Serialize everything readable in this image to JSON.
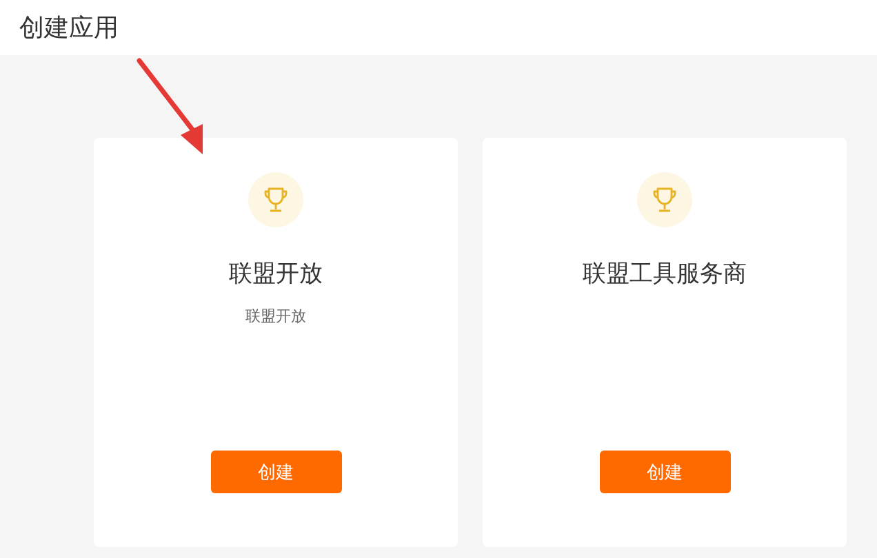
{
  "page": {
    "title": "创建应用"
  },
  "annotation": {
    "kind": "arrow"
  },
  "cards": [
    {
      "title": "联盟开放",
      "description": "联盟开放",
      "button": "创建"
    },
    {
      "title": "联盟工具服务商",
      "button": "创建"
    }
  ]
}
